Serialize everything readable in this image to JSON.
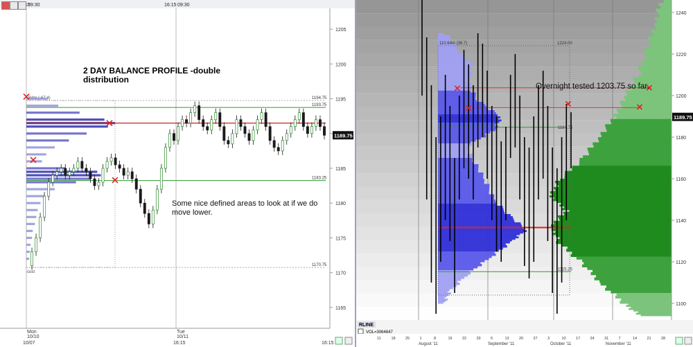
{
  "left": {
    "toolbar": {
      "time_a": "5:15",
      "time_b": "09:30",
      "time_c": "16:15",
      "time_d": "09:30"
    },
    "title_line1": "2 DAY BALANCE PROFILE -double",
    "title_line2": "distribution",
    "note_line1": "Some nice defined areas to look at if we do",
    "note_line2": "move lower.",
    "profile_label": "Bdm (-67.4)",
    "bottom_label": "cust",
    "ref_lines": [
      {
        "label": "1194.75",
        "value": 1194.75,
        "color": "#aaaaaa"
      },
      {
        "label": "1193.75",
        "value": 1193.75,
        "color": "#2e9b2e"
      },
      {
        "label": "1183.25",
        "value": 1183.25,
        "color": "#2e9b2e"
      },
      {
        "label": "1170.75",
        "value": 1170.75,
        "color": "#aaaaaa"
      }
    ],
    "poc": {
      "value": 1191.5,
      "color": "#c22020"
    },
    "price_badge": "1189.75",
    "y_axis": {
      "min": 1162,
      "max": 1208,
      "ticks": [
        "1205",
        "1200",
        "1195",
        "1190",
        "1185",
        "1180",
        "1175",
        "1170",
        "1165"
      ]
    },
    "x_labels": [
      {
        "line1": "Mon",
        "line2": "10/10"
      },
      {
        "line1": "Tue",
        "line2": "10/11"
      }
    ],
    "x_bottom": [
      "10/07",
      "16:15",
      "16:15"
    ]
  },
  "right": {
    "note": "Overnight tested 1203.75 so far.",
    "profile_label": "110.64m (36.7)",
    "top_label": "1224.00",
    "mid_label": "1184.75",
    "low_label": "1115.25",
    "price_badge": "1189.75",
    "y_axis": {
      "min": 1092,
      "max": 1246,
      "ticks": [
        "1240",
        "1220",
        "1200",
        "1180",
        "1160",
        "1140",
        "1120",
        "1100"
      ]
    },
    "indicator_title": "RLINE",
    "indicator_value": "VOL=3064647",
    "month_labels": [
      "August '11",
      "September '11",
      "October '11",
      "November '11"
    ],
    "day_ticks": [
      "11",
      "18",
      "25",
      "1",
      "8",
      "15",
      "22",
      "29",
      "6",
      "13",
      "20",
      "27",
      "3",
      "10",
      "17",
      "24",
      "31",
      "7",
      "14",
      "21",
      "28"
    ]
  },
  "chart_data": [
    {
      "type": "candlestick",
      "title": "2 DAY BALANCE PROFILE -double distribution",
      "ylim": [
        1162,
        1208
      ],
      "reference_levels": [
        1194.75,
        1193.75,
        1191.5,
        1183.25,
        1170.75
      ],
      "last_price": 1189.75,
      "price_path": [
        1171,
        1173,
        1175,
        1178,
        1181,
        1183,
        1184,
        1184.5,
        1185,
        1184,
        1184.5,
        1185,
        1186,
        1185,
        1184.5,
        1183.5,
        1182.5,
        1183,
        1185,
        1186,
        1186.5,
        1185.5,
        1185,
        1184,
        1184.5,
        1183.5,
        1182,
        1180,
        1178.5,
        1177,
        1179,
        1182,
        1185,
        1188,
        1190,
        1189,
        1191,
        1192,
        1191.5,
        1193,
        1194,
        1192,
        1191,
        1190.5,
        1192,
        1193,
        1191,
        1189,
        1188.5,
        1190,
        1192,
        1191,
        1190,
        1189,
        1190.5,
        1192,
        1193,
        1191,
        1189,
        1188,
        1187.5,
        1189,
        1190,
        1191,
        1192,
        1193,
        1191,
        1190,
        1191,
        1192,
        1191,
        1189.75
      ],
      "volume_profile": [
        {
          "price": 1195,
          "volume": 30
        },
        {
          "price": 1194,
          "volume": 45
        },
        {
          "price": 1193,
          "volume": 75
        },
        {
          "price": 1192,
          "volume": 110
        },
        {
          "price": 1191.5,
          "volume": 125
        },
        {
          "price": 1191,
          "volume": 115
        },
        {
          "price": 1190,
          "volume": 85
        },
        {
          "price": 1189,
          "volume": 60
        },
        {
          "price": 1188,
          "volume": 40
        },
        {
          "price": 1187,
          "volume": 28
        },
        {
          "price": 1186,
          "volume": 22
        },
        {
          "price": 1185,
          "volume": 55
        },
        {
          "price": 1184.5,
          "volume": 100
        },
        {
          "price": 1184,
          "volume": 105
        },
        {
          "price": 1183.5,
          "volume": 90
        },
        {
          "price": 1183,
          "volume": 70
        },
        {
          "price": 1182,
          "volume": 40
        },
        {
          "price": 1181,
          "volume": 26
        },
        {
          "price": 1180,
          "volume": 20
        },
        {
          "price": 1179,
          "volume": 16
        },
        {
          "price": 1178,
          "volume": 14
        },
        {
          "price": 1177,
          "volume": 12
        },
        {
          "price": 1176,
          "volume": 9
        },
        {
          "price": 1175,
          "volume": 8
        },
        {
          "price": 1174,
          "volume": 6
        },
        {
          "price": 1173,
          "volume": 5
        },
        {
          "price": 1172,
          "volume": 4
        }
      ]
    },
    {
      "type": "bar",
      "title": "",
      "ylim": [
        1092,
        1246
      ],
      "reference_levels": [
        1203.75,
        1194,
        1184.75,
        1136.5,
        1115.25
      ],
      "last_price": 1189.75,
      "daily_ranges": [
        {
          "high": 1250,
          "low": 1200
        },
        {
          "high": 1228,
          "low": 1150
        },
        {
          "high": 1205,
          "low": 1110
        },
        {
          "high": 1180,
          "low": 1095
        },
        {
          "high": 1190,
          "low": 1120
        },
        {
          "high": 1210,
          "low": 1140
        },
        {
          "high": 1195,
          "low": 1130
        },
        {
          "high": 1170,
          "low": 1105
        },
        {
          "high": 1200,
          "low": 1150
        },
        {
          "high": 1222,
          "low": 1165
        },
        {
          "high": 1215,
          "low": 1160
        },
        {
          "high": 1205,
          "low": 1150
        },
        {
          "high": 1230,
          "low": 1175
        },
        {
          "high": 1225,
          "low": 1180
        },
        {
          "high": 1212,
          "low": 1160
        },
        {
          "high": 1195,
          "low": 1140
        },
        {
          "high": 1190,
          "low": 1125
        },
        {
          "high": 1178,
          "low": 1120
        },
        {
          "high": 1185,
          "low": 1140
        },
        {
          "high": 1210,
          "low": 1170
        },
        {
          "high": 1220,
          "low": 1175
        },
        {
          "high": 1200,
          "low": 1150
        },
        {
          "high": 1180,
          "low": 1118
        },
        {
          "high": 1175,
          "low": 1112
        },
        {
          "high": 1190,
          "low": 1120
        },
        {
          "high": 1205,
          "low": 1150
        },
        {
          "high": 1212,
          "low": 1160
        },
        {
          "high": 1195,
          "low": 1130
        },
        {
          "high": 1175,
          "low": 1105
        },
        {
          "high": 1165,
          "low": 1095
        },
        {
          "high": 1180,
          "low": 1110
        },
        {
          "high": 1196,
          "low": 1140
        },
        {
          "high": 1192,
          "low": 1165
        }
      ],
      "volume_profile_blue": [
        {
          "price": 1230,
          "volume": 10
        },
        {
          "price": 1222,
          "volume": 30
        },
        {
          "price": 1215,
          "volume": 50
        },
        {
          "price": 1205,
          "volume": 45
        },
        {
          "price": 1198,
          "volume": 60
        },
        {
          "price": 1190,
          "volume": 95
        },
        {
          "price": 1184,
          "volume": 85
        },
        {
          "price": 1176,
          "volume": 40
        },
        {
          "price": 1168,
          "volume": 55
        },
        {
          "price": 1160,
          "volume": 70
        },
        {
          "price": 1150,
          "volume": 85
        },
        {
          "price": 1142,
          "volume": 110
        },
        {
          "price": 1136,
          "volume": 135
        },
        {
          "price": 1130,
          "volume": 110
        },
        {
          "price": 1122,
          "volume": 75
        },
        {
          "price": 1114,
          "volume": 40
        },
        {
          "price": 1106,
          "volume": 15
        },
        {
          "price": 1100,
          "volume": 5
        }
      ],
      "volume_profile_green": [
        {
          "price": 1246,
          "volume": 10
        },
        {
          "price": 1235,
          "volume": 18
        },
        {
          "price": 1222,
          "volume": 28
        },
        {
          "price": 1210,
          "volume": 40
        },
        {
          "price": 1200,
          "volume": 55
        },
        {
          "price": 1190,
          "volume": 70
        },
        {
          "price": 1180,
          "volume": 90
        },
        {
          "price": 1170,
          "volume": 110
        },
        {
          "price": 1160,
          "volume": 140
        },
        {
          "price": 1152,
          "volume": 150
        },
        {
          "price": 1145,
          "volume": 130
        },
        {
          "price": 1138,
          "volume": 150
        },
        {
          "price": 1130,
          "volume": 140
        },
        {
          "price": 1120,
          "volume": 110
        },
        {
          "price": 1110,
          "volume": 85
        },
        {
          "price": 1100,
          "volume": 55
        },
        {
          "price": 1094,
          "volume": 35
        }
      ]
    }
  ]
}
